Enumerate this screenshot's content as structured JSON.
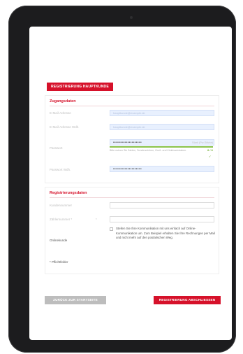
{
  "header": {
    "title": "REGISTRIERUNG HAUPTKUNDE"
  },
  "zugang": {
    "title": "Zugangsdaten",
    "email_label": "E-Mail-Adresse",
    "email_value": "hauptkunde@example.de",
    "email_confirm_label": "E-Mail-Adresse Wdh.",
    "email_confirm_value": "hauptkunde@example.de",
    "password_label": "Passwort",
    "password_value": "••••••••••••••••••••",
    "password_strength": "Stark (Pw-Stärke)",
    "password_hint": "Bitte nutzen Sie Zahlen, Sonderzeichen, Groß- und Kleinbuchstaben.",
    "password_hint_count": "8 / 8",
    "password_check": "✓",
    "password_confirm_label": "Passwort Wdh.",
    "password_confirm_value": "••••••••••••••••••••"
  },
  "registrierung": {
    "title": "Registrierungsdaten",
    "kundennummer_label": "Kundennummer",
    "kundennummer_value": "",
    "zaehler_label": "Zählernummer *",
    "zaehler_marker": "*",
    "zaehler_value": "",
    "online_label": "Onlinekunde",
    "online_text": "Stellen Sie Ihre Kommunikation mit uns einfach auf Online-Kommunikation um. Zum Beispiel erhalten Sie Ihre Rechnungen per Mail und nicht mehr auf den postalischen Weg.",
    "pflicht_label": "* Pflichtfelder"
  },
  "actions": {
    "back_label": "ZURÜCK ZUR STARTSEITE",
    "submit_label": "REGISTRIERUNG ABSCHLIESSEN"
  },
  "colors": {
    "accent": "#d6112a",
    "success": "#8bc34a",
    "field_fill": "#e8f0fe"
  }
}
